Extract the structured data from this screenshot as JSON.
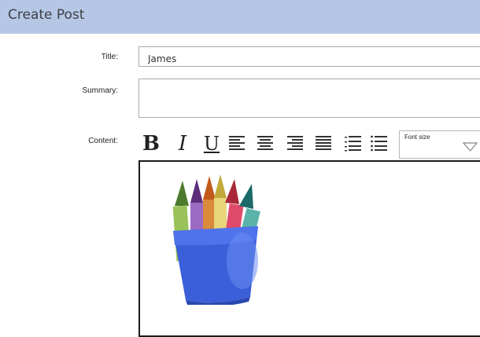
{
  "header": {
    "title": "Create Post"
  },
  "form": {
    "title_label": "Title:",
    "title_value": "James",
    "summary_label": "Summary:",
    "summary_value": "",
    "content_label": "Content:"
  },
  "toolbar": {
    "bold": "B",
    "italic": "I",
    "underline": "U",
    "font_size_label": "Font size"
  },
  "editor": {
    "image": "crayons-in-cup"
  },
  "colors": {
    "header_bg": "#b6c7e6",
    "cup_blue": "#3b5fd8"
  }
}
